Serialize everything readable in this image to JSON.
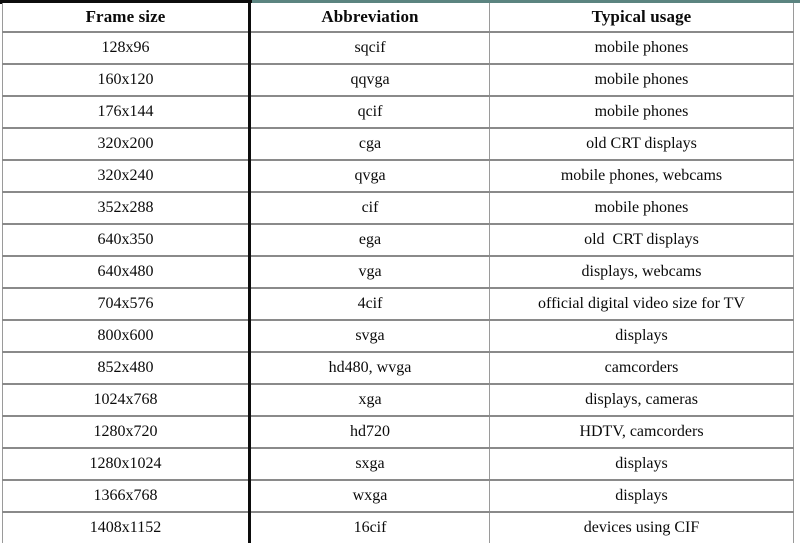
{
  "table": {
    "columns": [
      {
        "key": "frame_size",
        "label": "Frame size"
      },
      {
        "key": "abbreviation",
        "label": "Abbreviation"
      },
      {
        "key": "typical_usage",
        "label": "Typical usage"
      }
    ],
    "rows": [
      {
        "frame_size": "128x96",
        "abbreviation": "sqcif",
        "typical_usage": "mobile phones"
      },
      {
        "frame_size": "160x120",
        "abbreviation": "qqvga",
        "typical_usage": "mobile phones"
      },
      {
        "frame_size": "176x144",
        "abbreviation": "qcif",
        "typical_usage": "mobile phones"
      },
      {
        "frame_size": "320x200",
        "abbreviation": "cga",
        "typical_usage": "old CRT displays"
      },
      {
        "frame_size": "320x240",
        "abbreviation": "qvga",
        "typical_usage": "mobile phones, webcams"
      },
      {
        "frame_size": "352x288",
        "abbreviation": "cif",
        "typical_usage": "mobile phones"
      },
      {
        "frame_size": "640x350",
        "abbreviation": "ega",
        "typical_usage": "old  CRT displays"
      },
      {
        "frame_size": "640x480",
        "abbreviation": "vga",
        "typical_usage": "displays, webcams"
      },
      {
        "frame_size": "704x576",
        "abbreviation": "4cif",
        "typical_usage": "official digital video size for TV"
      },
      {
        "frame_size": "800x600",
        "abbreviation": "svga",
        "typical_usage": "displays"
      },
      {
        "frame_size": "852x480",
        "abbreviation": "hd480, wvga",
        "typical_usage": "camcorders"
      },
      {
        "frame_size": "1024x768",
        "abbreviation": "xga",
        "typical_usage": "displays, cameras"
      },
      {
        "frame_size": "1280x720",
        "abbreviation": "hd720",
        "typical_usage": "HDTV, camcorders"
      },
      {
        "frame_size": "1280x1024",
        "abbreviation": "sxga",
        "typical_usage": "displays"
      },
      {
        "frame_size": "1366x768",
        "abbreviation": "wxga",
        "typical_usage": "displays"
      },
      {
        "frame_size": "1408x1152",
        "abbreviation": "16cif",
        "typical_usage": "devices using CIF"
      }
    ]
  },
  "style": {
    "top_rule_black": "#0d0d0d",
    "top_rule_teal": "#5b8480",
    "row_rule": "#8a8a8a",
    "column_rule_thick": "#0d0d0d",
    "column_rule_thin": "#9a9a9a",
    "text": "#0a0a0a",
    "background": "#ffffff"
  }
}
